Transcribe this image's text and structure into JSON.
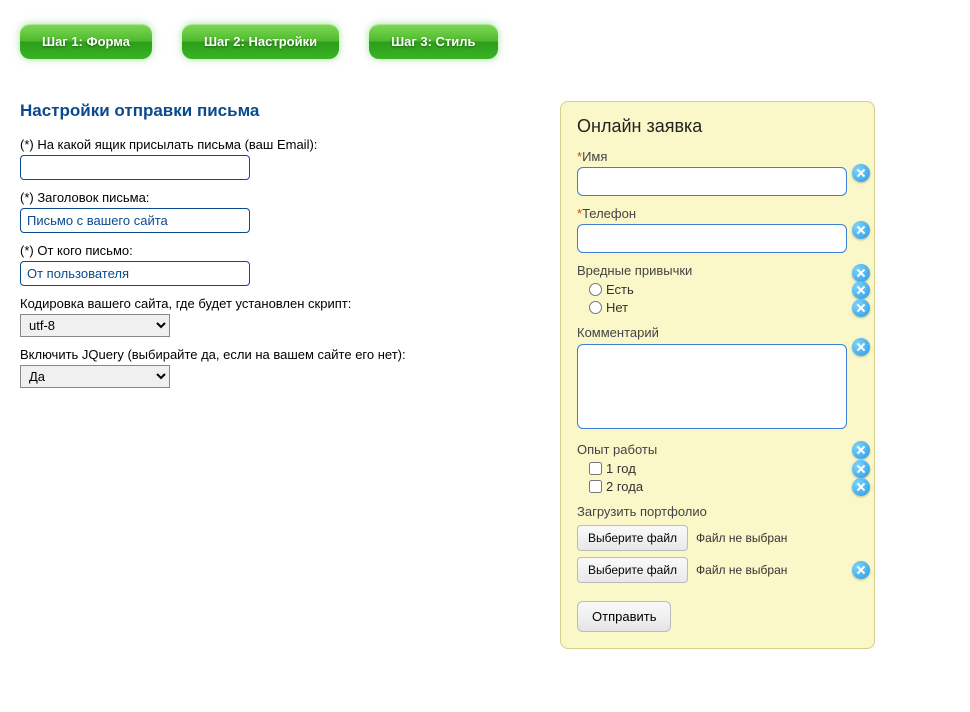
{
  "tabs": {
    "step1": "Шаг 1: Форма",
    "step2": "Шаг 2: Настройки",
    "step3": "Шаг 3: Стиль"
  },
  "settings": {
    "heading": "Настройки отправки письма",
    "email_label": "(*) На какой ящик присылать письма (ваш Email):",
    "email_value": "",
    "subject_label": "(*) Заголовок письма:",
    "subject_value": "Письмо с вашего сайта",
    "from_label": "(*) От кого письмо:",
    "from_value": "От пользователя",
    "encoding_label": "Кодировка вашего сайта, где будет установлен скрипт:",
    "encoding_value": "utf-8",
    "jquery_label": "Включить JQuery (выбирайте да, если на вашем сайте его нет):",
    "jquery_value": "Да"
  },
  "preview": {
    "title": "Онлайн заявка",
    "name_label": "Имя",
    "phone_label": "Телефон",
    "habits_label": "Вредные привычки",
    "habits_opt1": "Есть",
    "habits_opt2": "Нет",
    "comment_label": "Комментарий",
    "exp_label": "Опыт работы",
    "exp_opt1": "1 год",
    "exp_opt2": "2 года",
    "upload_label": "Загрузить портфолио",
    "file_btn": "Выберите файл",
    "file_hint": "Файл не выбран",
    "submit": "Отправить"
  }
}
